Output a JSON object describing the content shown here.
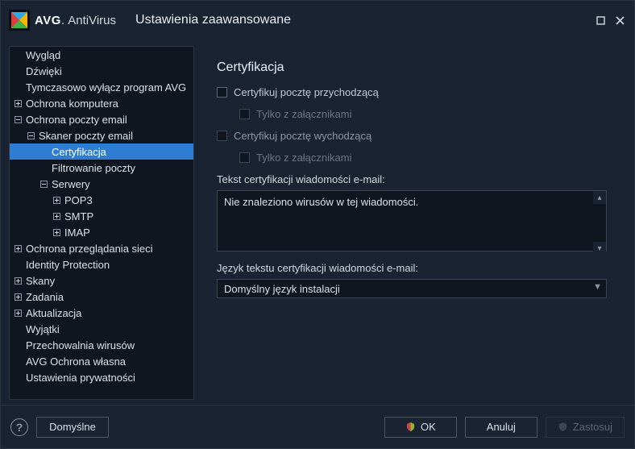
{
  "app": {
    "brand": "AVG",
    "product": "AntiVirus",
    "dot": "."
  },
  "window": {
    "title": "Ustawienia zaawansowane"
  },
  "sidebar": {
    "items": [
      {
        "label": "Wygląd",
        "depth": 1,
        "toggle": null
      },
      {
        "label": "Dźwięki",
        "depth": 1,
        "toggle": null
      },
      {
        "label": "Tymczasowo wyłącz program AVG",
        "depth": 1,
        "toggle": null
      },
      {
        "label": "Ochrona komputera",
        "depth": 1,
        "toggle": "plus"
      },
      {
        "label": "Ochrona poczty email",
        "depth": 1,
        "toggle": "minus"
      },
      {
        "label": "Skaner poczty email",
        "depth": 2,
        "toggle": "minus"
      },
      {
        "label": "Certyfikacja",
        "depth": 3,
        "toggle": null,
        "selected": true
      },
      {
        "label": "Filtrowanie poczty",
        "depth": 3,
        "toggle": null
      },
      {
        "label": "Serwery",
        "depth": 3,
        "toggle": "minus"
      },
      {
        "label": "POP3",
        "depth": 4,
        "toggle": "plus"
      },
      {
        "label": "SMTP",
        "depth": 4,
        "toggle": "plus"
      },
      {
        "label": "IMAP",
        "depth": 4,
        "toggle": "plus"
      },
      {
        "label": "Ochrona przeglądania sieci",
        "depth": 1,
        "toggle": "plus"
      },
      {
        "label": "Identity Protection",
        "depth": 1,
        "toggle": null
      },
      {
        "label": "Skany",
        "depth": 1,
        "toggle": "plus"
      },
      {
        "label": "Zadania",
        "depth": 1,
        "toggle": "plus"
      },
      {
        "label": "Aktualizacja",
        "depth": 1,
        "toggle": "plus"
      },
      {
        "label": "Wyjątki",
        "depth": 1,
        "toggle": null
      },
      {
        "label": "Przechowalnia wirusów",
        "depth": 1,
        "toggle": null
      },
      {
        "label": "AVG Ochrona własna",
        "depth": 1,
        "toggle": null
      },
      {
        "label": "Ustawienia prywatności",
        "depth": 1,
        "toggle": null
      }
    ]
  },
  "content": {
    "title": "Certyfikacja",
    "cb_incoming": "Certyfikuj pocztę przychodzącą",
    "cb_incoming_att": "Tylko z załącznikami",
    "cb_outgoing": "Certyfikuj pocztę wychodzącą",
    "cb_outgoing_att": "Tylko z załącznikami",
    "cert_text_label": "Tekst certyfikacji wiadomości e-mail:",
    "cert_text_value": "Nie znaleziono wirusów w tej wiadomości.",
    "lang_label": "Język tekstu certyfikacji wiadomości e-mail:",
    "lang_value": "Domyślny język instalacji"
  },
  "footer": {
    "defaults": "Domyślne",
    "ok": "OK",
    "cancel": "Anuluj",
    "apply": "Zastosuj"
  }
}
